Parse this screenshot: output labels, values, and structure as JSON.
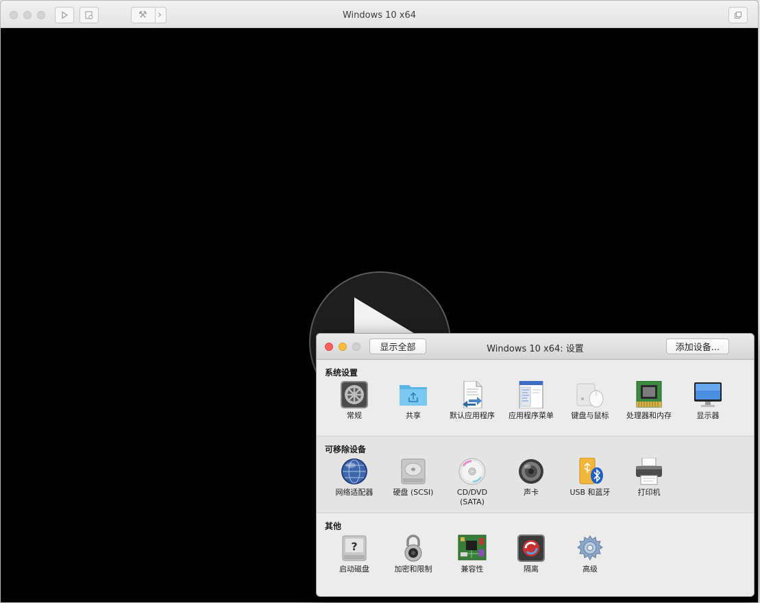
{
  "vm_window": {
    "title": "Windows 10 x64",
    "wrench_symbol": "⚒",
    "chevron_symbol": "›"
  },
  "settings": {
    "title": "Windows 10 x64: 设置",
    "show_all_label": "显示全部",
    "add_device_label": "添加设备...",
    "sections": {
      "system": {
        "title": "系统设置",
        "items": [
          "常规",
          "共享",
          "默认应用程序",
          "应用程序菜单",
          "键盘与鼠标",
          "处理器和内存",
          "显示器"
        ]
      },
      "removable": {
        "title": "可移除设备",
        "items": [
          "网络适配器",
          "硬盘 (SCSI)",
          "CD/DVD\n(SATA)",
          "声卡",
          "USB 和蓝牙",
          "打印机"
        ]
      },
      "other": {
        "title": "其他",
        "items": [
          "启动磁盘",
          "加密和限制",
          "兼容性",
          "隔离",
          "高级"
        ]
      }
    }
  },
  "colors": {
    "close": "#fc605c",
    "minimize": "#fdbc40",
    "zoom_disabled": "#d0d0d0"
  }
}
